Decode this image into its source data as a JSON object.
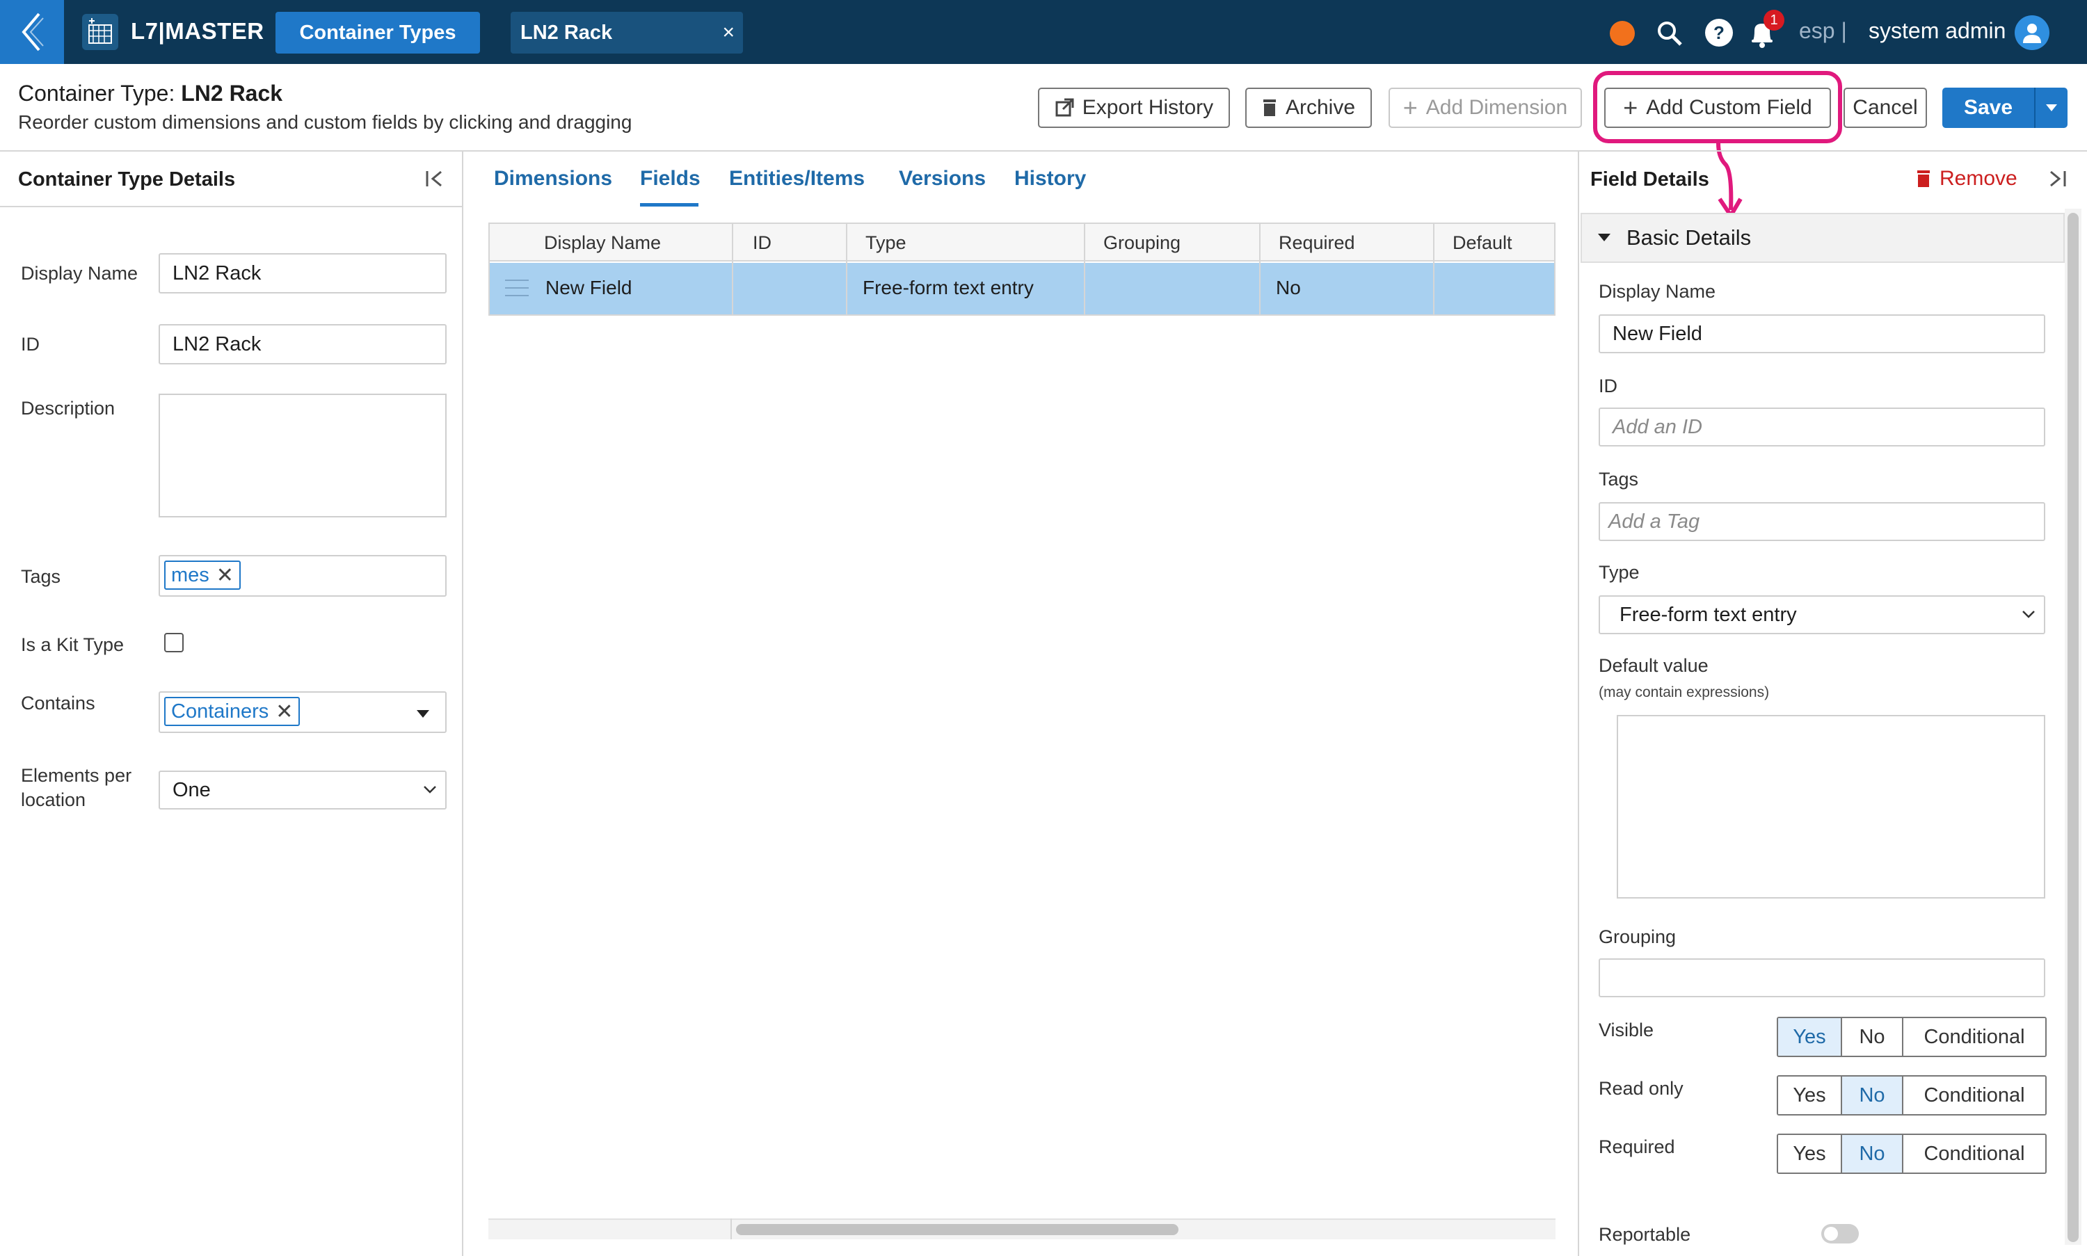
{
  "nav": {
    "app_title": "L7|MASTER",
    "tabs": [
      {
        "label": "Container Types"
      },
      {
        "label": "LN2 Rack",
        "close": "×"
      }
    ],
    "notification_count": "1",
    "environment": "esp",
    "separator": "|",
    "user": "system admin",
    "status_color": "#f2711c"
  },
  "header": {
    "title_prefix": "Container Type:",
    "title_name": "LN2 Rack",
    "subtitle": "Reorder custom dimensions and custom fields by clicking and dragging",
    "buttons": {
      "export_history": "Export History",
      "archive": "Archive",
      "add_dimension": "Add Dimension",
      "add_custom_field": "Add Custom Field",
      "cancel": "Cancel",
      "save": "Save"
    }
  },
  "left_panel": {
    "title": "Container Type Details",
    "fields": {
      "display_name_label": "Display Name",
      "display_name_value": "LN2 Rack",
      "id_label": "ID",
      "id_value": "LN2 Rack",
      "description_label": "Description",
      "tags_label": "Tags",
      "tags": [
        "mes"
      ],
      "kit_label": "Is a Kit Type",
      "contains_label": "Contains",
      "contains": [
        "Containers"
      ],
      "elements_label_line1": "Elements per",
      "elements_label_line2": "location",
      "elements_value": "One"
    }
  },
  "middle": {
    "tabs": [
      "Dimensions",
      "Fields",
      "Entities/Items",
      "Versions",
      "History"
    ],
    "active_tab": "Fields",
    "columns": [
      "Display Name",
      "ID",
      "Type",
      "Grouping",
      "Required",
      "Default"
    ],
    "rows": [
      {
        "display_name": "New Field",
        "id": "",
        "type": "Free-form text entry",
        "grouping": "",
        "required": "No",
        "default": ""
      }
    ]
  },
  "right_panel": {
    "title": "Field Details",
    "remove": "Remove",
    "section": "Basic Details",
    "display_name_label": "Display Name",
    "display_name_value": "New Field",
    "id_label": "ID",
    "id_placeholder": "Add an ID",
    "tags_label": "Tags",
    "tags_placeholder": "Add a Tag",
    "type_label": "Type",
    "type_value": "Free-form text entry",
    "default_label": "Default value",
    "default_hint": "(may contain expressions)",
    "grouping_label": "Grouping",
    "visible_label": "Visible",
    "read_only_label": "Read only",
    "required_label": "Required",
    "reportable_label": "Reportable",
    "seg_options": [
      "Yes",
      "No",
      "Conditional"
    ],
    "visible_selected": "Yes",
    "read_only_selected": "No",
    "required_selected": "No",
    "reportable_on": false
  },
  "colors": {
    "nav_bg": "#0d3756",
    "accent": "#1f78c8",
    "highlight": "#e0197d",
    "danger": "#cc1f1f",
    "selected_row": "#a8d0f0"
  }
}
